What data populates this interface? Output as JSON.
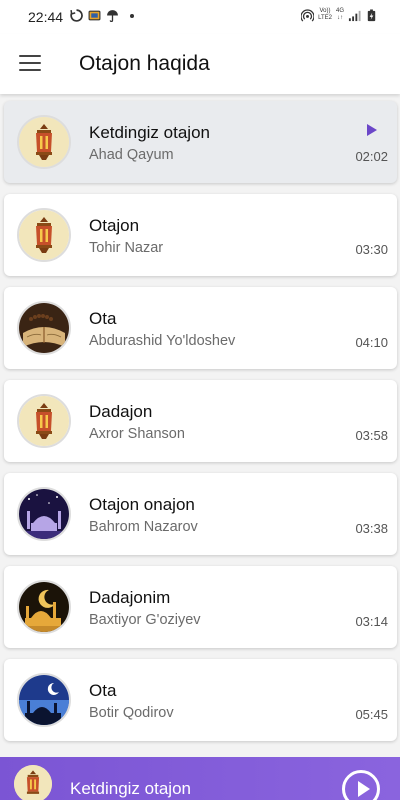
{
  "status_bar": {
    "time": "22:44",
    "network_top": "Vo))",
    "network_bottom": "LTE2",
    "signal_label": "4G"
  },
  "header": {
    "title": "Otajon haqida",
    "menu_icon": "hamburger-menu-icon"
  },
  "songs": [
    {
      "title": "Ketdingiz otajon",
      "artist": "Ahad Qayum",
      "duration": "02:02",
      "thumbnail": "lantern",
      "active": true
    },
    {
      "title": "Otajon",
      "artist": "Tohir Nazar",
      "duration": "03:30",
      "thumbnail": "lantern"
    },
    {
      "title": "Ota",
      "artist": "Abdurashid Yo'ldoshev",
      "duration": "04:10",
      "thumbnail": "quran-beads"
    },
    {
      "title": "Dadajon",
      "artist": "Axror Shanson",
      "duration": "03:58",
      "thumbnail": "lantern"
    },
    {
      "title": "Otajon onajon",
      "artist": "Bahrom Nazarov",
      "duration": "03:38",
      "thumbnail": "mosque-night-purple"
    },
    {
      "title": "Dadajonim",
      "artist": "Baxtiyor G'oziyev",
      "duration": "03:14",
      "thumbnail": "mosque-gold"
    },
    {
      "title": "Ota",
      "artist": "Botir Qodirov",
      "duration": "05:45",
      "thumbnail": "mosque-night-blue"
    }
  ],
  "player": {
    "title": "Ketdingiz otajon",
    "play_icon": "play-circle-icon"
  },
  "colors": {
    "accent": "#7b55d4",
    "active_row": "#e9ebee"
  }
}
